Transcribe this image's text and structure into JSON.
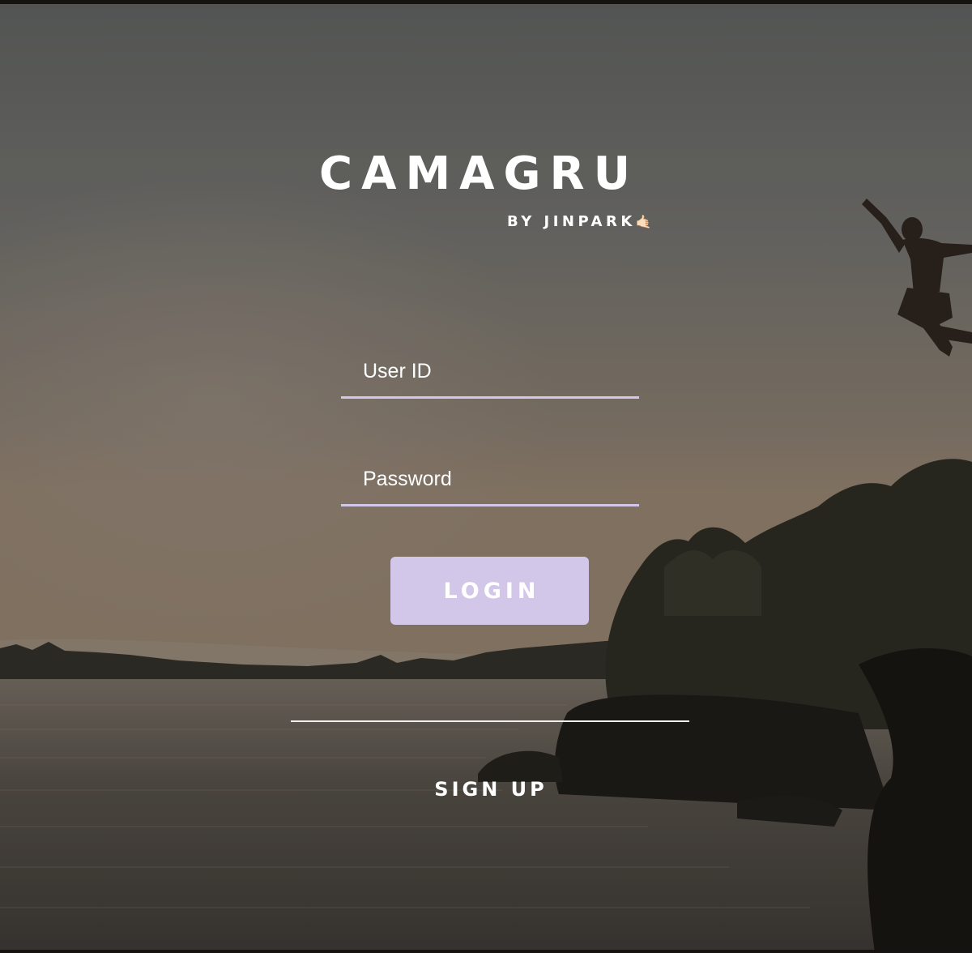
{
  "logo": {
    "title": "CAMAGRU",
    "byline": "BY JINPARK",
    "byline_emoji": "🤙🏻"
  },
  "login_form": {
    "user_id_placeholder": "User ID",
    "password_placeholder": "Password",
    "login_label": "LOGIN"
  },
  "signup": {
    "label": "SIGN UP"
  },
  "colors": {
    "accent": "#d2c6e9",
    "text": "#ffffff",
    "divider": "#f1efec"
  },
  "background": {
    "scene": "sunset-lake-cliff-jump-photo"
  }
}
